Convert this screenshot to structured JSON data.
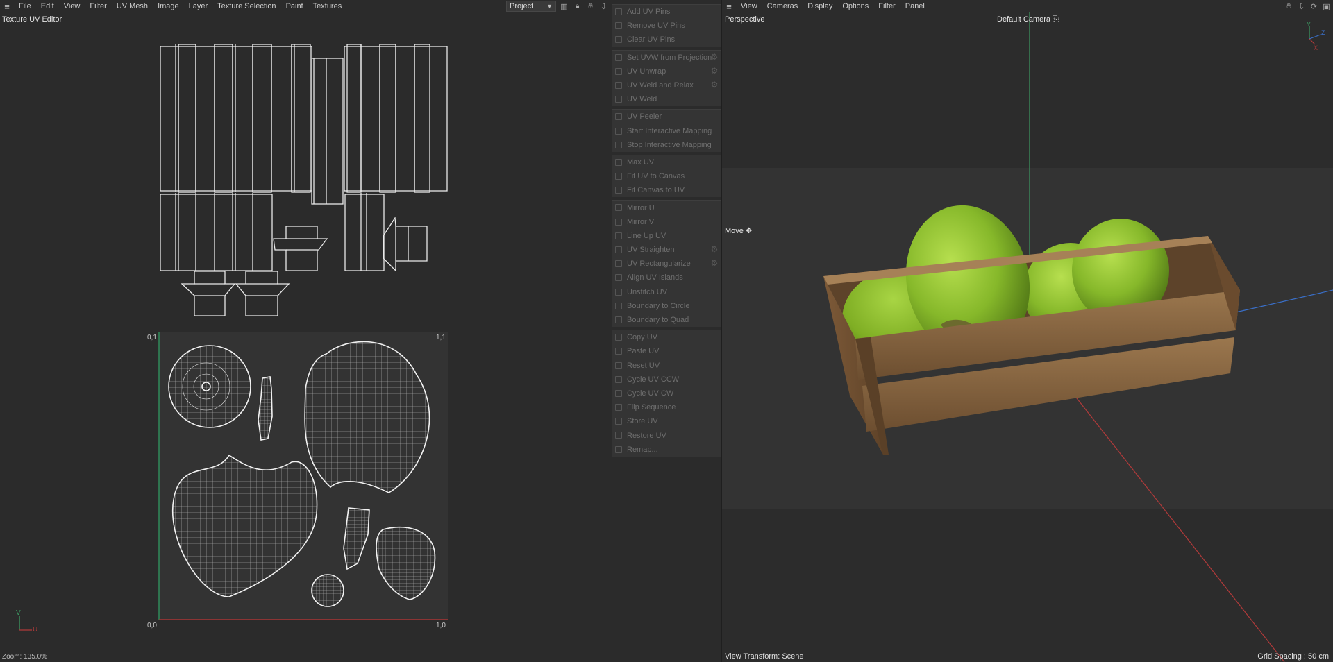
{
  "uv_editor": {
    "menu": [
      "File",
      "Edit",
      "View",
      "Filter",
      "UV Mesh",
      "Image",
      "Layer",
      "Texture Selection",
      "Paint",
      "Textures"
    ],
    "title": "Texture UV Editor",
    "project_select": "Project",
    "tool_icons": [
      "histogram-icon",
      "lock-icon",
      "hand-icon",
      "pin-icon"
    ],
    "corner_labels": {
      "top_left": "0,1",
      "top_right": "1,1",
      "bottom_left": "0,0",
      "bottom_right": "1,0"
    },
    "axis": {
      "v": "V",
      "u": "U"
    },
    "zoom": "Zoom: 135.0%"
  },
  "commands": {
    "groups": [
      [
        {
          "label": "Add UV Pins",
          "icon": "pin-add-icon"
        },
        {
          "label": "Remove UV Pins",
          "icon": "pin-remove-icon"
        },
        {
          "label": "Clear UV Pins",
          "icon": "pin-clear-icon"
        }
      ],
      [
        {
          "label": "Set UVW from Projection",
          "icon": "projection-icon",
          "gear": true
        },
        {
          "label": "UV Unwrap",
          "icon": "unwrap-icon",
          "gear": true
        },
        {
          "label": "UV Weld and Relax",
          "icon": "weld-relax-icon",
          "gear": true
        },
        {
          "label": "UV Weld",
          "icon": "weld-icon"
        }
      ],
      [
        {
          "label": "UV Peeler",
          "icon": "peeler-icon"
        },
        {
          "label": "Start Interactive Mapping",
          "icon": "play-icon"
        },
        {
          "label": "Stop Interactive Mapping",
          "icon": "stop-icon"
        }
      ],
      [
        {
          "label": "Max UV",
          "icon": "max-uv-icon"
        },
        {
          "label": "Fit UV to Canvas",
          "icon": "fit-uv-icon"
        },
        {
          "label": "Fit Canvas to UV",
          "icon": "fit-canvas-icon"
        }
      ],
      [
        {
          "label": "Mirror U",
          "icon": "mirror-u-icon"
        },
        {
          "label": "Mirror V",
          "icon": "mirror-v-icon"
        },
        {
          "label": "Line Up UV",
          "icon": "line-up-icon"
        },
        {
          "label": "UV Straighten",
          "icon": "straighten-icon",
          "gear": true
        },
        {
          "label": "UV Rectangularize",
          "icon": "rectangularize-icon",
          "gear": true
        },
        {
          "label": "Align UV Islands",
          "icon": "align-icon"
        },
        {
          "label": "Unstitch UV",
          "icon": "unstitch-icon"
        },
        {
          "label": "Boundary to Circle",
          "icon": "circle-icon"
        },
        {
          "label": "Boundary to Quad",
          "icon": "quad-icon"
        }
      ],
      [
        {
          "label": "Copy UV",
          "icon": "copy-icon"
        },
        {
          "label": "Paste UV",
          "icon": "paste-icon"
        },
        {
          "label": "Reset UV",
          "icon": "reset-icon"
        },
        {
          "label": "Cycle UV CCW",
          "icon": "cycle-ccw-icon"
        },
        {
          "label": "Cycle UV CW",
          "icon": "cycle-cw-icon"
        },
        {
          "label": "Flip Sequence",
          "icon": "flip-icon"
        },
        {
          "label": "Store UV",
          "icon": "store-icon"
        },
        {
          "label": "Restore UV",
          "icon": "restore-icon"
        },
        {
          "label": "Remap...",
          "icon": "remap-icon"
        }
      ]
    ]
  },
  "viewport": {
    "menu": [
      "View",
      "Cameras",
      "Display",
      "Options",
      "Filter",
      "Panel"
    ],
    "tool_icons": [
      "hand-icon",
      "move-icon",
      "rotate-icon",
      "maximize-icon"
    ],
    "projection": "Perspective",
    "camera": "Default Camera",
    "tool": "Move",
    "view_transform": "View Transform: Scene",
    "grid_spacing": "Grid Spacing : 50 cm",
    "gizmo": {
      "y": "Y",
      "z": "Z",
      "x": "X"
    }
  },
  "colors": {
    "axis_green": "#3c9a62",
    "axis_red": "#b03a3a",
    "axis_blue": "#3a6fc8",
    "fruit_green": "#8cc02c",
    "crate_wood": "#8a6541"
  }
}
